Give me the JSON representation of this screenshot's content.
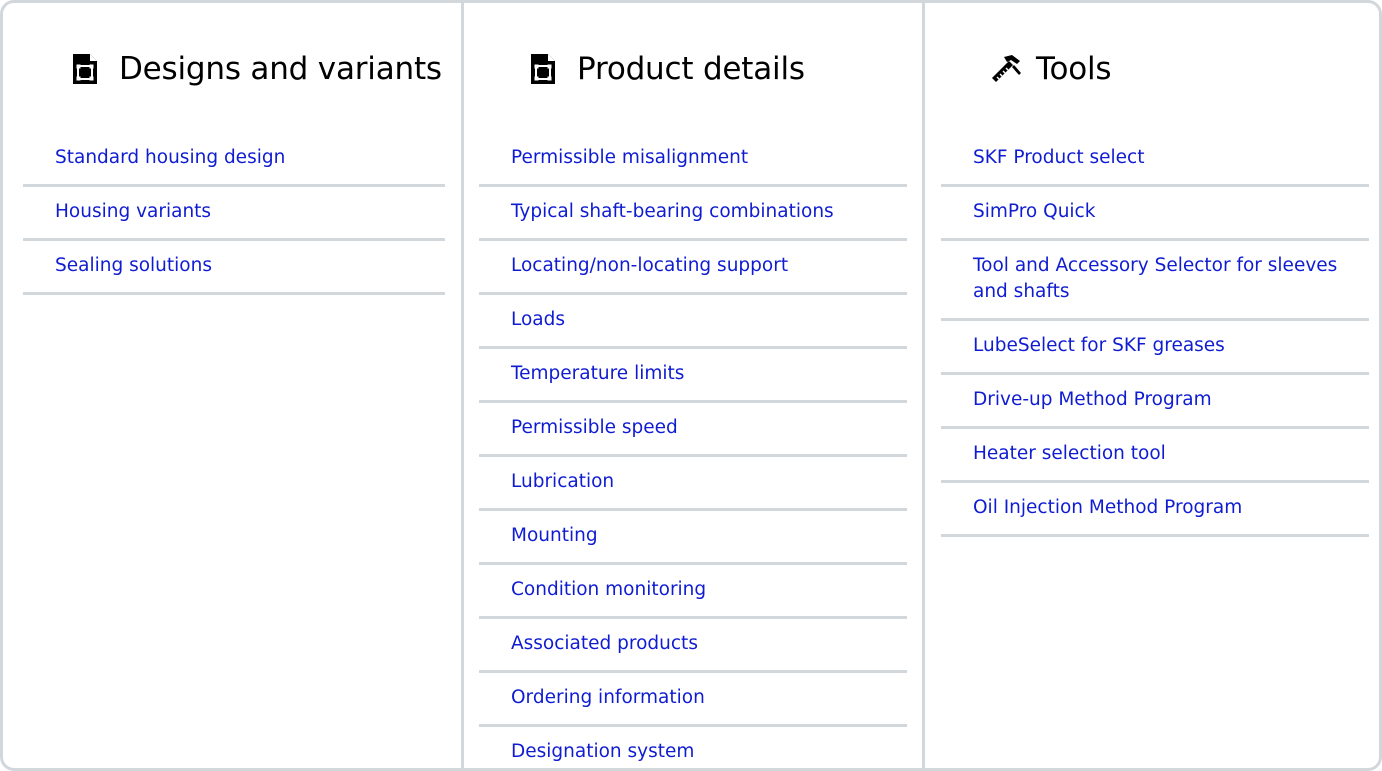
{
  "columns": [
    {
      "title": "Designs and variants",
      "icon": "document-icon",
      "links": [
        "Standard housing design",
        "Housing variants",
        "Sealing solutions"
      ]
    },
    {
      "title": "Product details",
      "icon": "document-icon",
      "links": [
        "Permissible misalignment",
        "Typical shaft-bearing combinations",
        "Locating/non-locating support",
        "Loads",
        "Temperature limits",
        "Permissible speed",
        "Lubrication",
        "Mounting",
        "Condition monitoring",
        "Associated products",
        "Ordering information",
        "Designation system"
      ]
    },
    {
      "title": "Tools",
      "icon": "tools-icon",
      "links": [
        "SKF Product select",
        "SimPro Quick",
        "Tool and Accessory Selector for sleeves and shafts",
        "LubeSelect for SKF greases",
        "Drive-up Method Program",
        "Heater selection tool",
        "Oil Injection Method Program"
      ]
    }
  ],
  "colors": {
    "link": "#0f1cd2",
    "divider": "#d2d7dc",
    "title": "#000000"
  }
}
